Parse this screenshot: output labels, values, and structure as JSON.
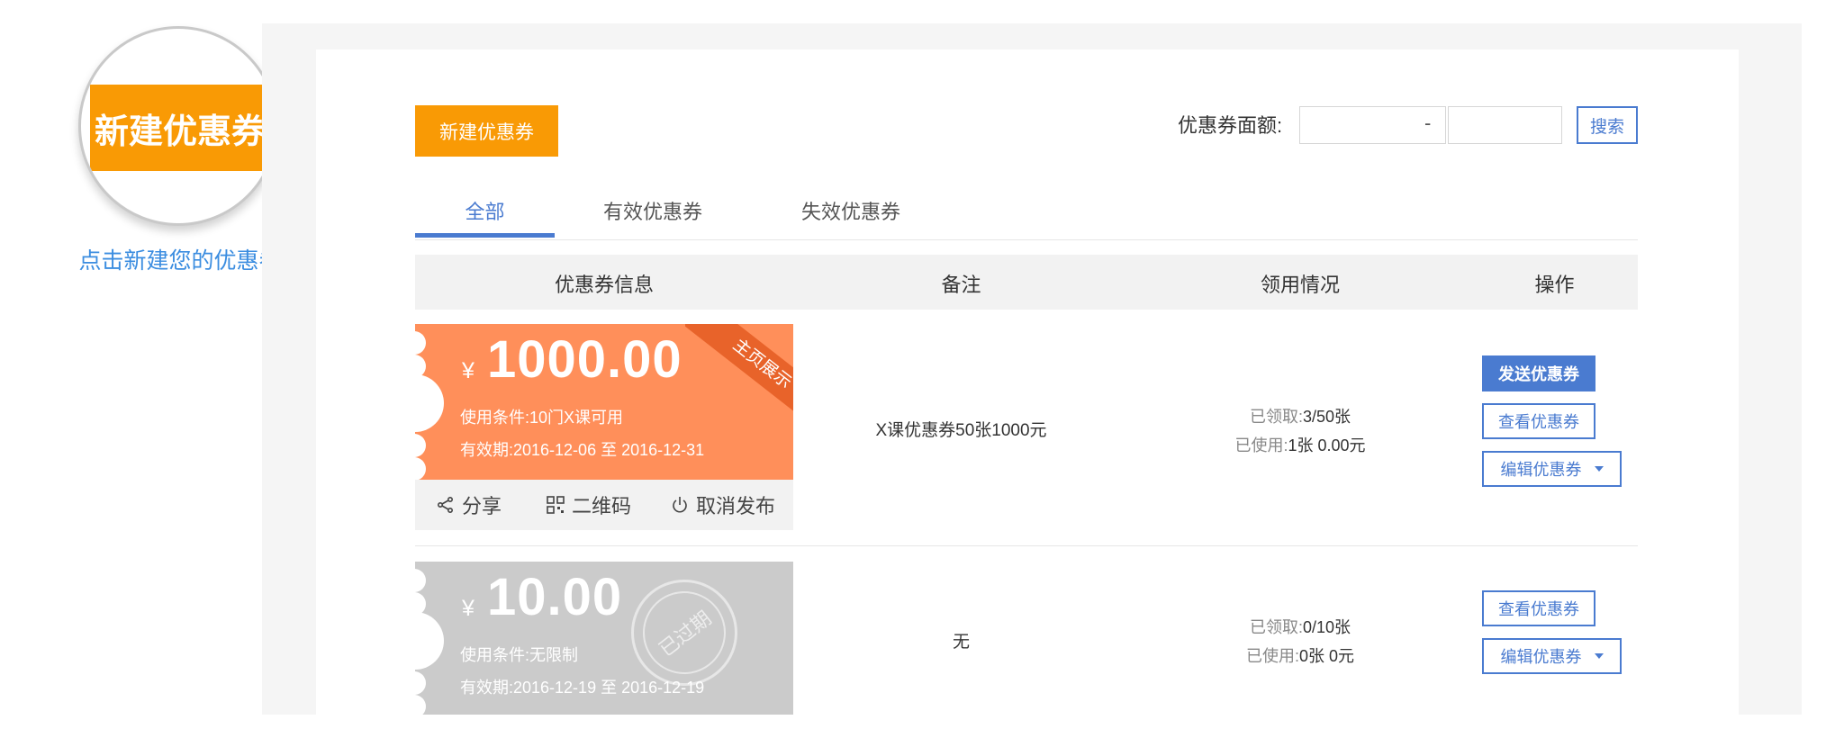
{
  "hint": {
    "lens_label": "新建优惠券",
    "caption": "点击新建您的优惠卷"
  },
  "toolbar": {
    "new_coupon": "新建优惠券",
    "amount_label": "优惠券面额:",
    "min_placeholder": "",
    "max_placeholder": "",
    "dash": "-",
    "search": "搜索"
  },
  "tabs": [
    {
      "label": "全部",
      "active": true
    },
    {
      "label": "有效优惠券",
      "active": false
    },
    {
      "label": "失效优惠券",
      "active": false
    }
  ],
  "table": {
    "headers": [
      "优惠券信息",
      "备注",
      "领用情况",
      "操作"
    ],
    "rows": [
      {
        "yen": "¥",
        "amount": "1000.00",
        "condition": "使用条件:10门X课可用",
        "validity": "有效期:2016-12-06 至 2016-12-31",
        "ribbon": "主页展示",
        "actions": [
          "分享",
          "二维码",
          "取消发布"
        ],
        "note": "X课优惠券50张1000元",
        "claimed_label": "已领取:",
        "claimed_value": "3/50张",
        "used_label": "已使用:",
        "used_value": "1张  0.00元",
        "ops": {
          "send": "发送优惠券",
          "view": "查看优惠券",
          "edit": "编辑优惠券"
        }
      },
      {
        "yen": "¥",
        "amount": "10.00",
        "condition": "使用条件:无限制",
        "validity": "有效期:2016-12-19 至 2016-12-19",
        "stamp": "已过期",
        "note": "无",
        "claimed_label": "已领取:",
        "claimed_value": "0/10张",
        "used_label": "已使用:",
        "used_value": "0张  0元",
        "ops": {
          "view": "查看优惠券",
          "edit": "编辑优惠券"
        }
      }
    ]
  },
  "colors": {
    "accent": "#4a7bd0",
    "orange_button": "#f99a05",
    "coupon_active": "#ff8f5a",
    "coupon_expired": "#cbcbcb",
    "ribbon": "#e8632a",
    "hint_text": "#3b8de0"
  }
}
